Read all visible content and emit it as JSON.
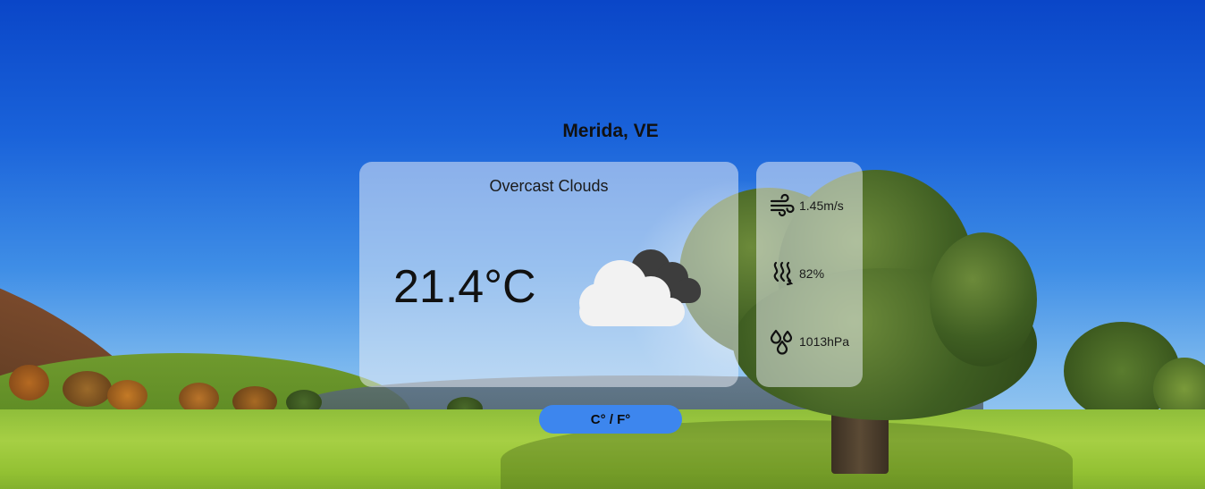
{
  "location": "Merida, VE",
  "weather": {
    "description": "Overcast Clouds",
    "temperature": "21.4°C",
    "icon": "overcast-clouds-icon"
  },
  "stats": [
    {
      "icon": "wind-icon",
      "value": "1.45m/s"
    },
    {
      "icon": "humidity-icon",
      "value": "82%"
    },
    {
      "icon": "pressure-icon",
      "value": "1013hPa"
    }
  ],
  "unit_toggle_label": "C° / F°",
  "colors": {
    "toggle_button": "#3d86ee",
    "panel": "rgba(235,240,248,0.52)",
    "text": "#111111"
  }
}
